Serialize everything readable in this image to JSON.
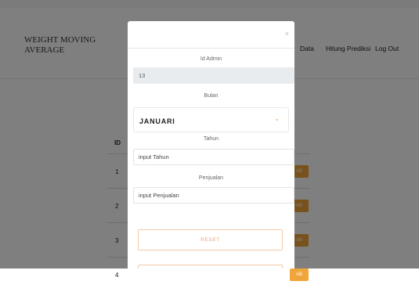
{
  "brand": {
    "title": "WEIGHT MOVING AVERAGE"
  },
  "nav": {
    "items": [
      "Data",
      "Hitung Prediksi",
      "Log Out"
    ]
  },
  "table": {
    "header_id": "ID",
    "rows": [
      {
        "id": "1",
        "action": "AB"
      },
      {
        "id": "2",
        "action": "AB"
      },
      {
        "id": "3",
        "action": "AB"
      },
      {
        "id": "4",
        "action": "AB"
      }
    ]
  },
  "modal": {
    "close": "×",
    "fields": {
      "id_admin": {
        "label": "Id Admin",
        "value": "13"
      },
      "bulan": {
        "label": "Bulan",
        "value": "JANUARI"
      },
      "tahun": {
        "label": "Tahun",
        "placeholder": "input Tahun"
      },
      "penjualan": {
        "label": "Penjualan",
        "placeholder": "input Penjualan"
      }
    },
    "reset_label": "RESET"
  }
}
